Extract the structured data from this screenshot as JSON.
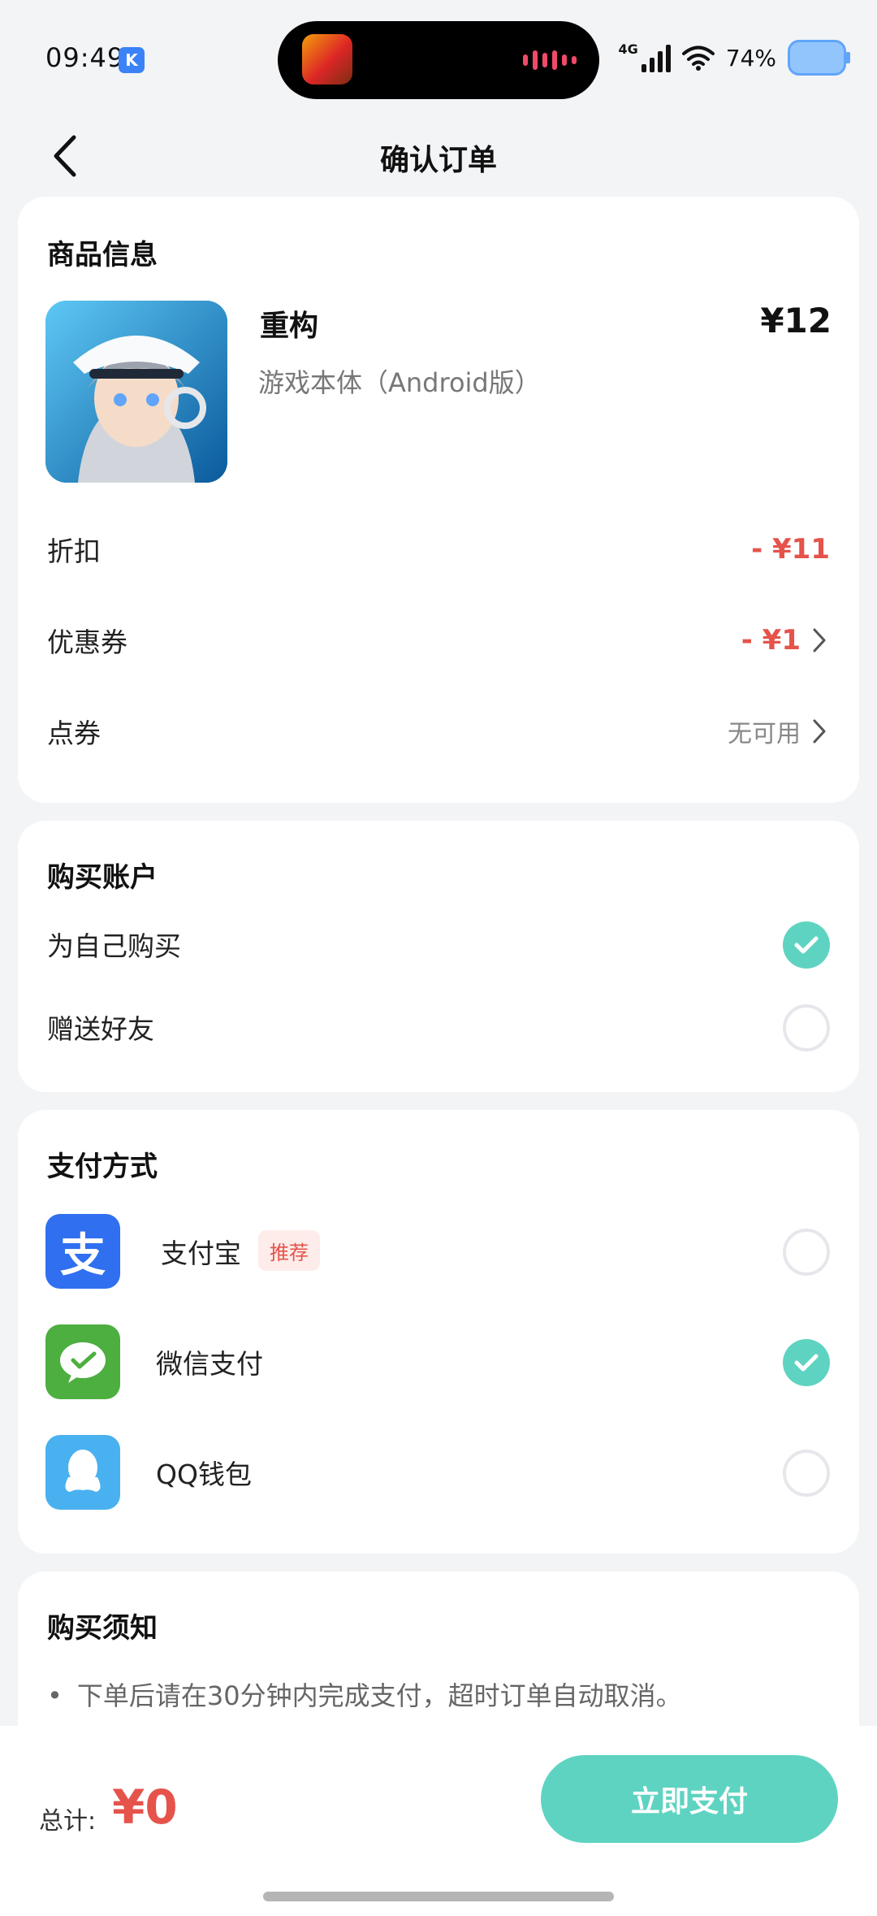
{
  "status_bar": {
    "time": "09:49",
    "network": "4G",
    "battery": "74%",
    "app_badge": "K"
  },
  "nav": {
    "title": "确认订单"
  },
  "product_card": {
    "section_title": "商品信息",
    "product": {
      "name": "重构",
      "sku": "游戏本体（Android版）",
      "price": "¥12"
    },
    "rows": [
      {
        "label": "折扣",
        "value": "- ¥11"
      },
      {
        "label": "优惠券",
        "value": "- ¥1"
      },
      {
        "label": "点券",
        "value": "无可用"
      }
    ]
  },
  "account_card": {
    "section_title": "购买账户",
    "options": [
      {
        "label": "为自己购买",
        "selected": true
      },
      {
        "label": "赠送好友",
        "selected": false
      }
    ]
  },
  "payment_card": {
    "section_title": "支付方式",
    "methods": [
      {
        "label": "支付宝",
        "tag": "推荐",
        "selected": false,
        "icon": "alipay-icon",
        "icon_char": "支",
        "color": "#2f6ff0"
      },
      {
        "label": "微信支付",
        "selected": true,
        "icon": "wechat-pay-icon",
        "color": "#4caf3f"
      },
      {
        "label": "QQ钱包",
        "selected": false,
        "icon": "qq-wallet-icon",
        "color": "#4ab1f0"
      }
    ]
  },
  "notice_card": {
    "section_title": "购买须知",
    "items": [
      "下单后请在30分钟内完成支付，超时订单自动取消。"
    ]
  },
  "bottom_bar": {
    "total_label": "总计:",
    "total_amount": "¥0",
    "pay_button": "立即支付"
  },
  "colors": {
    "accent": "#5fd3c1",
    "price_red": "#e5534b",
    "background": "#f3f4f6"
  }
}
